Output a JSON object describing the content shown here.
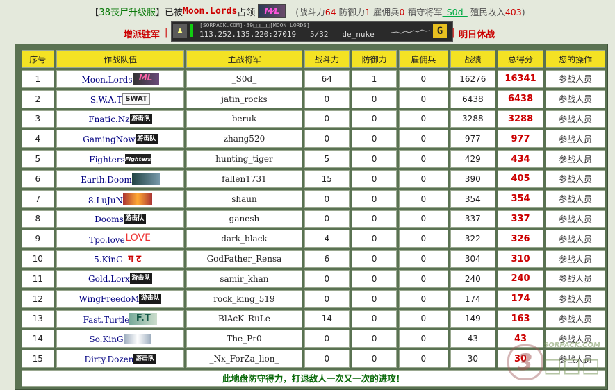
{
  "header": {
    "server_bracket_open": "【",
    "server_name": "38丧尸升级服",
    "server_bracket_close": "】",
    "occupied_by_prefix": "已被",
    "occupier": "Moon.Lords",
    "occupied_suffix": "占领",
    "stats_open": "(战斗力",
    "attack": "64",
    "defense_label": "防御力",
    "defense": "1",
    "merc_label": "雇佣兵",
    "merc": "0",
    "general_label": "镇守将军",
    "general": "_S0d_",
    "income_label": "殖民收入",
    "income": "403",
    "stats_close": ")"
  },
  "actions": {
    "reinforce": "增派驻军",
    "ceasefire": "明日休战",
    "separator": "|"
  },
  "server_banner": {
    "line1": "[SORPACK.COM]-39□□□□□[MOON_LORDS]",
    "address": "113.252.135.220:27019",
    "players": "5/32",
    "map": "de_nuke"
  },
  "table": {
    "columns": [
      "序号",
      "作战队伍",
      "主战将军",
      "战斗力",
      "防御力",
      "雇佣兵",
      "战绩",
      "总得分",
      "您的操作"
    ],
    "rows": [
      {
        "no": "1",
        "team": "Moon.Lords",
        "logo": "ML",
        "general": "_S0d_",
        "attack": "64",
        "defense": "1",
        "merc": "0",
        "record": "16276",
        "score": "16341",
        "action": "参战人员"
      },
      {
        "no": "2",
        "team": "S.W.A.T",
        "logo": "SWAT",
        "general": "jatin_rocks",
        "attack": "0",
        "defense": "0",
        "merc": "0",
        "record": "6438",
        "score": "6438",
        "action": "参战人员"
      },
      {
        "no": "3",
        "team": "Fnatic.Nz",
        "logo": "游击队",
        "general": "beruk",
        "attack": "0",
        "defense": "0",
        "merc": "0",
        "record": "3288",
        "score": "3288",
        "action": "参战人员"
      },
      {
        "no": "4",
        "team": "GamingNow",
        "logo": "游击队",
        "general": "zhang520",
        "attack": "0",
        "defense": "0",
        "merc": "0",
        "record": "977",
        "score": "977",
        "action": "参战人员"
      },
      {
        "no": "5",
        "team": "Fighters",
        "logo": "Fighters",
        "general": "hunting_tiger",
        "attack": "5",
        "defense": "0",
        "merc": "0",
        "record": "429",
        "score": "434",
        "action": "参战人员"
      },
      {
        "no": "6",
        "team": "Earth.Doom",
        "logo": "",
        "general": "fallen1731",
        "attack": "15",
        "defense": "0",
        "merc": "0",
        "record": "390",
        "score": "405",
        "action": "参战人员"
      },
      {
        "no": "7",
        "team": "8.LuJuN",
        "logo": "",
        "general": "shaun",
        "attack": "0",
        "defense": "0",
        "merc": "0",
        "record": "354",
        "score": "354",
        "action": "参战人员"
      },
      {
        "no": "8",
        "team": "Dooms",
        "logo": "游击队",
        "general": "ganesh",
        "attack": "0",
        "defense": "0",
        "merc": "0",
        "record": "337",
        "score": "337",
        "action": "参战人员"
      },
      {
        "no": "9",
        "team": "Tpo.love",
        "logo": "LOVE",
        "general": "dark_black",
        "attack": "4",
        "defense": "0",
        "merc": "0",
        "record": "322",
        "score": "326",
        "action": "参战人员"
      },
      {
        "no": "10",
        "team": "5.KinG",
        "logo": "ग ट",
        "general": "GodFather_Rensa",
        "attack": "6",
        "defense": "0",
        "merc": "0",
        "record": "304",
        "score": "310",
        "action": "参战人员"
      },
      {
        "no": "11",
        "team": "Gold.Lorx",
        "logo": "游击队",
        "general": "samir_khan",
        "attack": "0",
        "defense": "0",
        "merc": "0",
        "record": "240",
        "score": "240",
        "action": "参战人员"
      },
      {
        "no": "12",
        "team": "WingFreedoM",
        "logo": "游击队",
        "general": "rock_king_519",
        "attack": "0",
        "defense": "0",
        "merc": "0",
        "record": "174",
        "score": "174",
        "action": "参战人员"
      },
      {
        "no": "13",
        "team": "Fast.Turtle",
        "logo": "F.T",
        "general": "BlAcK_RuLe",
        "attack": "14",
        "defense": "0",
        "merc": "0",
        "record": "149",
        "score": "163",
        "action": "参战人员"
      },
      {
        "no": "14",
        "team": "So.KinG",
        "logo": "",
        "general": "The_Pr0",
        "attack": "0",
        "defense": "0",
        "merc": "0",
        "record": "43",
        "score": "43",
        "action": "参战人员"
      },
      {
        "no": "15",
        "team": "Dirty.Dozen",
        "logo": "游击队",
        "general": "_Nx_ForZa_lion_",
        "attack": "0",
        "defense": "0",
        "merc": "0",
        "record": "30",
        "score": "30",
        "action": "参战人员"
      }
    ],
    "footer": "此地盘防守得力，打退敌人一次又一次的进攻！"
  },
  "colors": {
    "header_yellow": "#f4e224",
    "panel_green": "#5a7252",
    "score_red": "#cc0000",
    "footer_green": "#0a6a0a"
  }
}
